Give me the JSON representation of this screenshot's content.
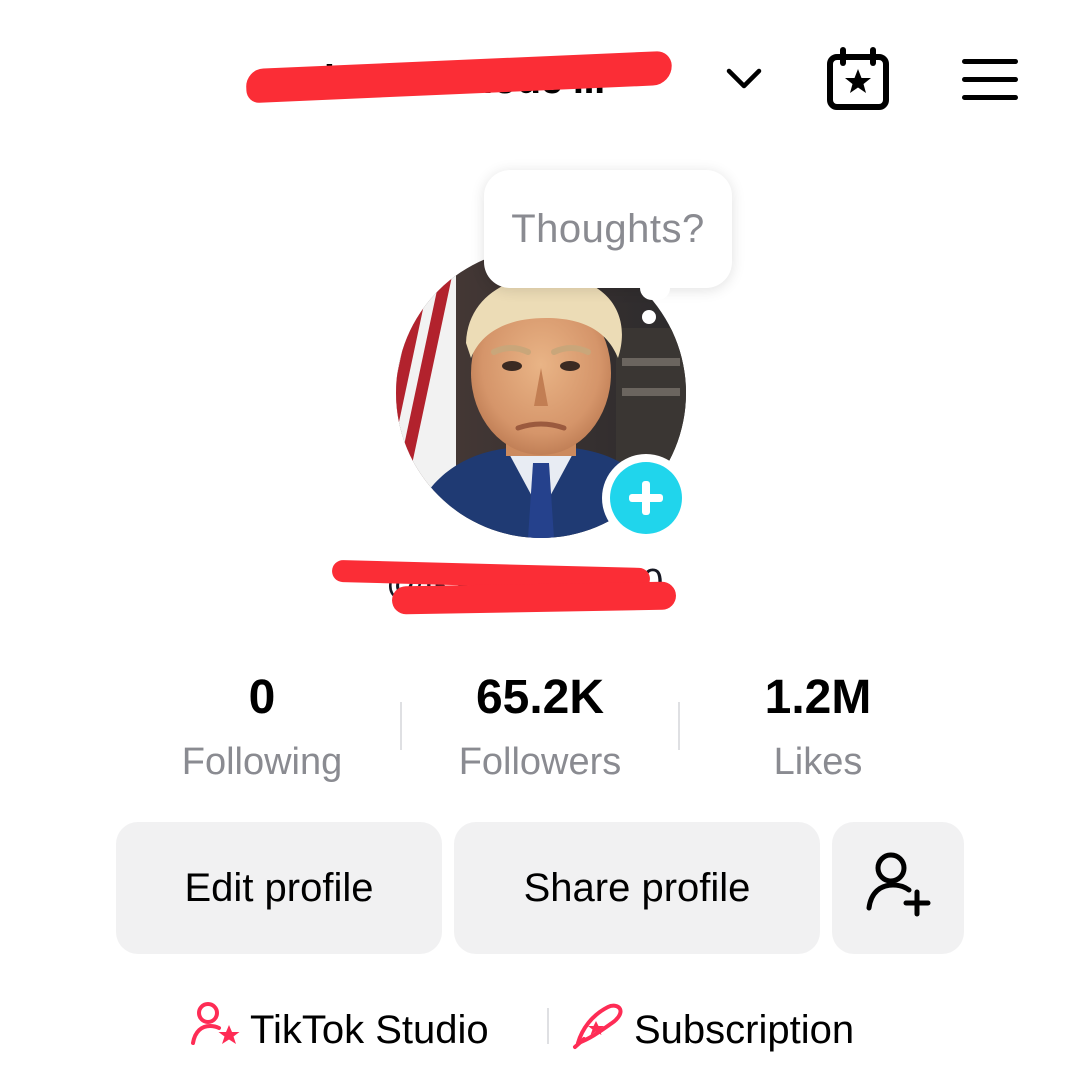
{
  "header": {
    "username": "motivation Mode ...",
    "icons": {
      "dropdown": "chevron-down-icon",
      "calendar": "calendar-star-icon",
      "menu": "hamburger-menu-icon"
    }
  },
  "avatar": {
    "bubble_text": "Thoughts?",
    "add_icon": "plus-icon",
    "add_color": "#20d5ec"
  },
  "profile": {
    "handle": "@ikshsbnilmkh0"
  },
  "stats": [
    {
      "value": "0",
      "label": "Following"
    },
    {
      "value": "65.2K",
      "label": "Followers"
    },
    {
      "value": "1.2M",
      "label": "Likes"
    }
  ],
  "actions": {
    "edit_label": "Edit profile",
    "share_label": "Share profile",
    "add_friend_icon": "add-friend-icon"
  },
  "links": {
    "studio_label": "TikTok Studio",
    "subscription_label": "Subscription",
    "accent": "#fe2c55"
  },
  "colors": {
    "redaction": "#fb2d36",
    "muted_text": "#8a8b91",
    "button_bg": "#f1f1f2"
  }
}
